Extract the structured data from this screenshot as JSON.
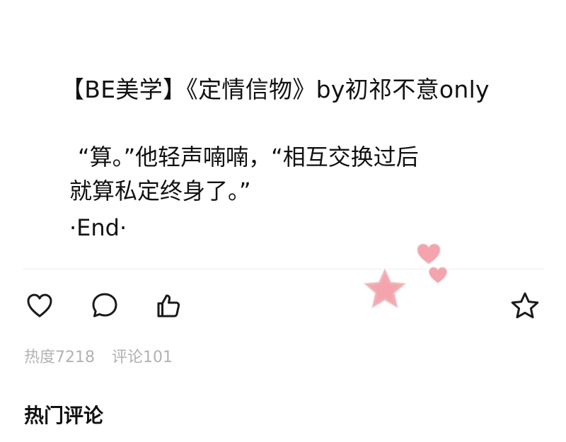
{
  "post": {
    "title": "【BE美学】《定情信物》by初祁不意only",
    "lines": [
      "“算。”他轻声喃喃，“相互交换过后",
      "就算私定终身了。”",
      "·End·"
    ]
  },
  "actions": {
    "like_icon": "heart-outline",
    "comment_icon": "speech-bubble-outline",
    "share_icon": "thumbs-up-outline",
    "favorite_icon": "star-outline"
  },
  "stats": {
    "heat": "热度7218",
    "comments": "评论101"
  },
  "hot_comments": {
    "title": "热门评论"
  },
  "colors": {
    "text": "#111111",
    "muted": "#b2b2b2",
    "sticker_fill": "#f4a4ac",
    "sticker_outline": "#ffffff",
    "divider": "#ececec"
  }
}
